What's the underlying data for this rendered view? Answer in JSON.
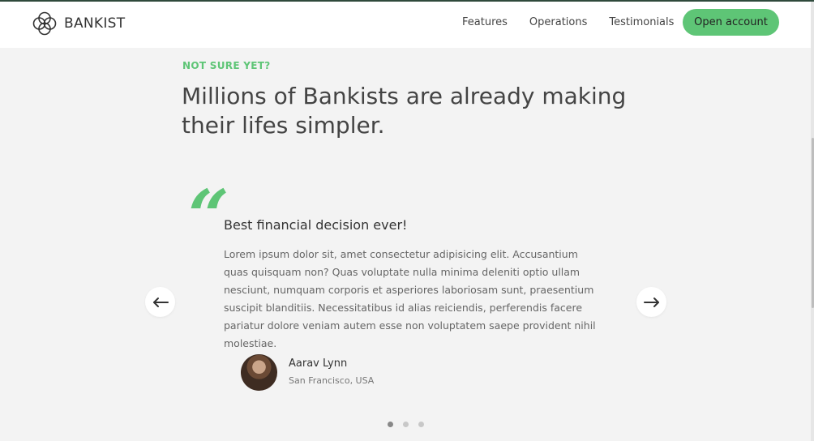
{
  "nav": {
    "brand": "BANKIST",
    "links": [
      "Features",
      "Operations",
      "Testimonials"
    ],
    "cta": "Open account"
  },
  "section": {
    "label": "NOT SURE YET?",
    "heading": "Millions of Bankists are already making their lifes simpler."
  },
  "testimonial": {
    "quote_mark": "“",
    "title": "Best financial decision ever!",
    "text": "Lorem ipsum dolor sit, amet consectetur adipisicing elit. Accusantium quas quisquam non? Quas voluptate nulla minima deleniti optio ullam nesciunt, numquam corporis et asperiores laboriosam sunt, praesentium suscipit blanditiis. Necessitatibus id alias reiciendis, perferendis facere pariatur dolore veniam autem esse non voluptatem saepe provident nihil molestiae.",
    "author_name": "Aarav Lynn",
    "author_location": "San Francisco, USA"
  },
  "slider": {
    "left_icon": "arrow-left-icon",
    "right_icon": "arrow-right-icon",
    "dot_count": 3,
    "active_dot": 0
  },
  "colors": {
    "accent": "#5ec576",
    "background": "#f3f3f3",
    "nav_background": "#ffffff"
  }
}
